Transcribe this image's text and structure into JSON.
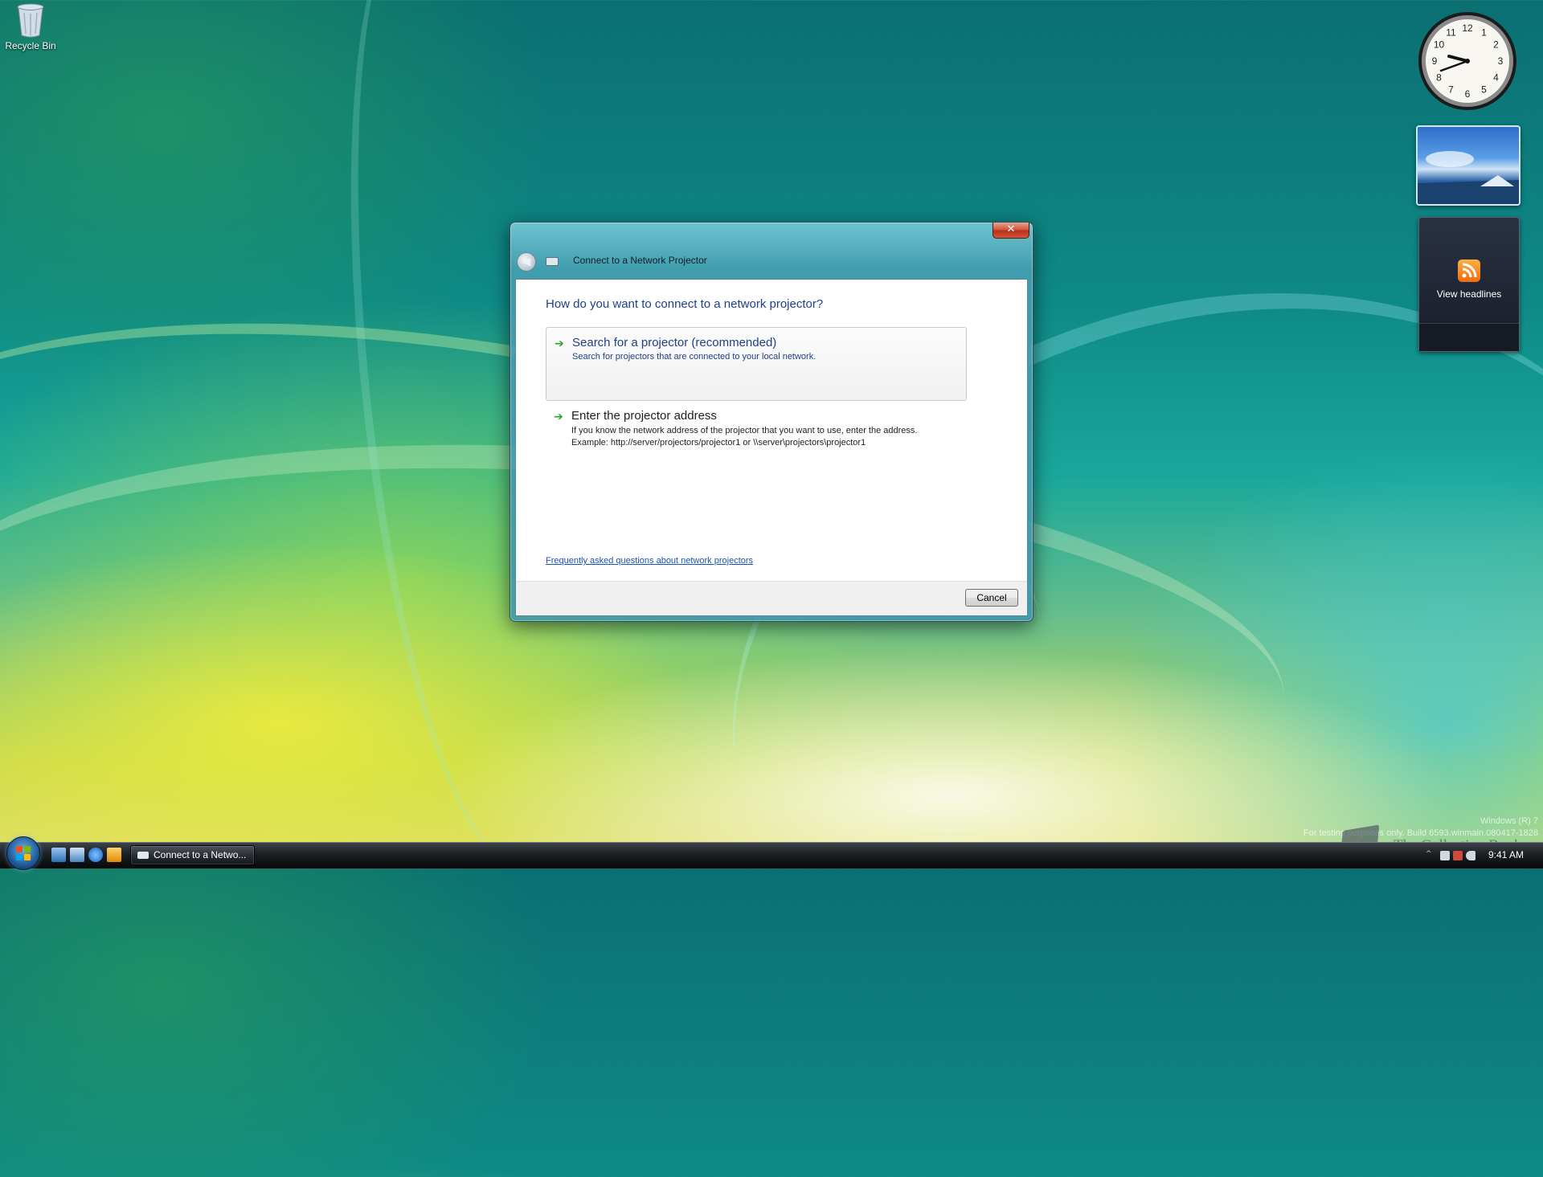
{
  "desktop": {
    "recycle_bin_label": "Recycle Bin"
  },
  "gadgets": {
    "clock": {
      "numbers": [
        "12",
        "1",
        "2",
        "3",
        "4",
        "5",
        "6",
        "7",
        "8",
        "9",
        "10",
        "11"
      ],
      "time_shown": "9:41"
    },
    "feed": {
      "label": "View headlines"
    }
  },
  "dialog": {
    "title": "Connect to a Network Projector",
    "close_glyph": "✕",
    "back_glyph": "◀",
    "heading": "How do you want to connect to a network projector?",
    "option_search": {
      "title": "Search for a projector (recommended)",
      "description": "Search for projectors that are connected to your local network."
    },
    "option_address": {
      "title": "Enter the projector address",
      "description_line1": "If you know the network address of the projector that you want to use, enter the address.",
      "description_line2": "Example: http://server/projectors/projector1 or \\\\server\\projectors\\projector1"
    },
    "arrow_glyph": "➔",
    "faq_link": "Frequently asked questions about network projectors",
    "cancel_label": "Cancel"
  },
  "watermark": {
    "line1": "Windows (R) 7",
    "line2": "For testing purposes only. Build 6593.winmain.080417-1828",
    "brand": "The Collection Book"
  },
  "taskbar": {
    "task_button_label": "Connect to a Netwo...",
    "clock": "9:41 AM"
  },
  "colors": {
    "link_blue": "#1654b8",
    "heading_blue": "#1e3f8a",
    "arrow_green": "#2aa12e"
  }
}
